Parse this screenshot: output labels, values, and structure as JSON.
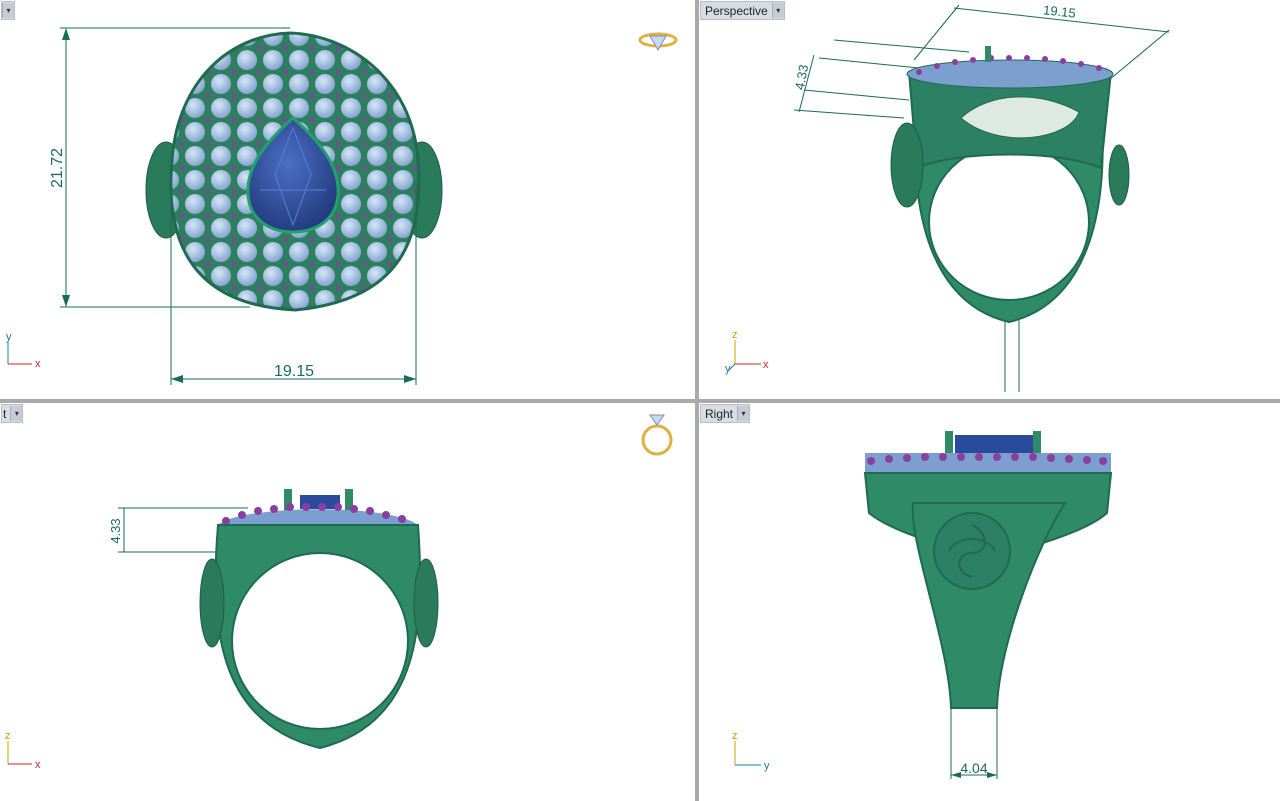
{
  "viewports": {
    "top": {
      "label": "",
      "dim_height": "21.72",
      "dim_width": "19.15"
    },
    "perspective": {
      "label": "Perspective",
      "dim_height": "4.33",
      "dim_width": "19.15"
    },
    "front": {
      "label": "t",
      "dim_height": "4.33"
    },
    "right": {
      "label": "Right",
      "dim_width": "4.04"
    }
  },
  "axes": {
    "top": {
      "v": "y",
      "h": "x"
    },
    "perspective": {
      "v": "z",
      "h": "x",
      "d": "y"
    },
    "front": {
      "v": "z",
      "h": "x"
    },
    "right": {
      "v": "z",
      "h": "y"
    }
  },
  "colors": {
    "metal": "#2f8a68",
    "metal_dark": "#1f6b4f",
    "stone_blue": "#8fb1da",
    "center_stone": "#2a4a9c",
    "accent_purple": "#8a3fa0",
    "dimension": "#1a6b55",
    "axis_x": "#cc2222",
    "axis_y": "#1a7fa0",
    "axis_z": "#c8a000"
  }
}
